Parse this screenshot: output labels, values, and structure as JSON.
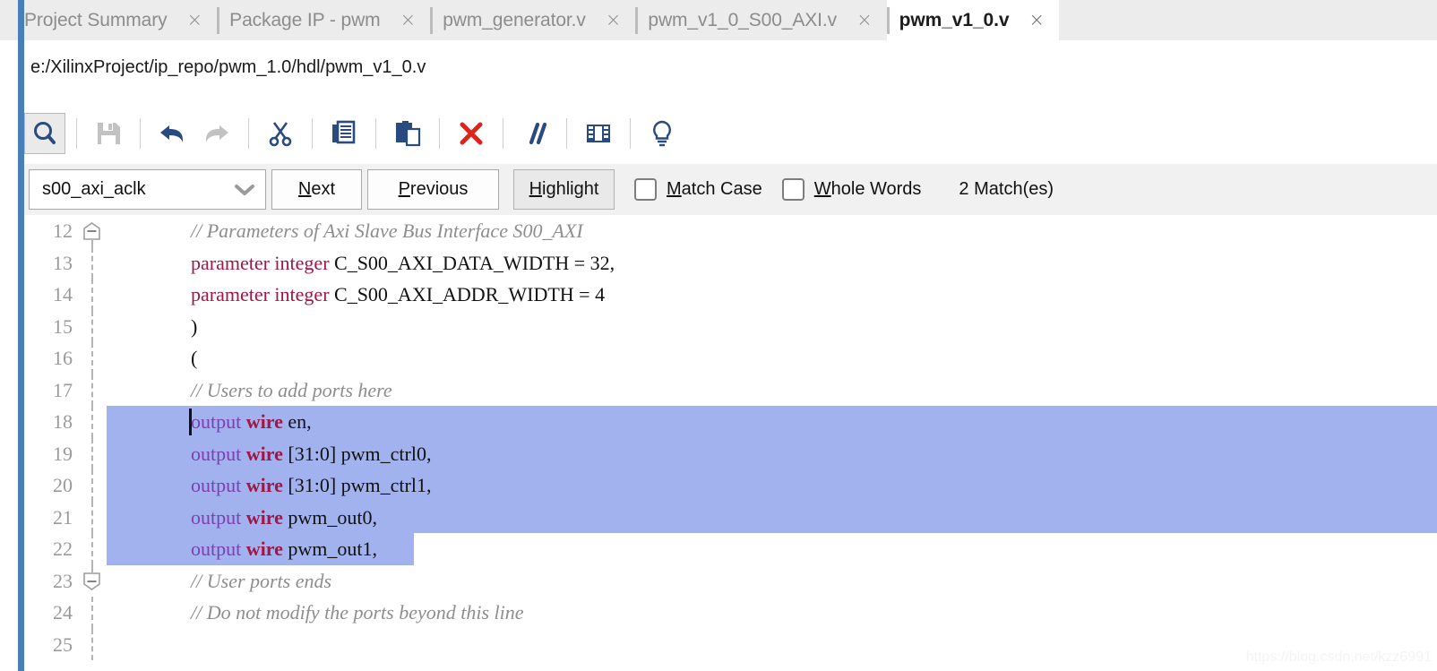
{
  "window": {
    "accent_color": "#4a7ebb",
    "tabbar_bg": "#ececec",
    "selection_color": "#a2b2ef",
    "keyword_color": "#a31545",
    "output_keyword_color": "#7c3fb0",
    "comment_color": "#8e8e8e"
  },
  "tabs": [
    {
      "label": "Project Summary",
      "close": "×",
      "active": false
    },
    {
      "label": "Package IP - pwm",
      "close": "×",
      "active": false
    },
    {
      "label": "pwm_generator.v",
      "close": "×",
      "active": false
    },
    {
      "label": "pwm_v1_0_S00_AXI.v",
      "close": "×",
      "active": false
    },
    {
      "label": "pwm_v1_0.v",
      "close": "×",
      "active": true
    }
  ],
  "filepath": {
    "text": "e:/XilinxProject/ip_repo/pwm_1.0/hdl/pwm_v1_0.v"
  },
  "toolbar": {
    "items": [
      {
        "name": "search-icon",
        "title": "Find",
        "state": "pressed"
      },
      {
        "name": "save-icon",
        "title": "Save File",
        "state": "disabled"
      },
      {
        "name": "undo-icon",
        "title": "Undo",
        "state": "enabled"
      },
      {
        "name": "redo-icon",
        "title": "Redo",
        "state": "disabled"
      },
      {
        "name": "cut-icon",
        "title": "Cut",
        "state": "enabled"
      },
      {
        "name": "copy-icon",
        "title": "Copy",
        "state": "enabled"
      },
      {
        "name": "paste-icon",
        "title": "Paste",
        "state": "enabled"
      },
      {
        "name": "delete-icon",
        "title": "Delete",
        "state": "enabled"
      },
      {
        "name": "comment-icon",
        "title": "Toggle Comment",
        "state": "enabled"
      },
      {
        "name": "split-view-icon",
        "title": "Split View",
        "state": "enabled"
      },
      {
        "name": "bulb-icon",
        "title": "Hints",
        "state": "enabled"
      }
    ]
  },
  "findbar": {
    "search_value": "s00_axi_aclk",
    "search_placeholder": "Find",
    "next_pre": "N",
    "next_post": "ext",
    "previous_pre": "P",
    "previous_post": "revious",
    "highlight_pre": "H",
    "highlight_post": "ighlight",
    "highlight_toggled": true,
    "match_case_pre": "M",
    "match_case_post": "atch Case",
    "match_case_checked": false,
    "whole_words_pre": "W",
    "whole_words_post": "hole Words",
    "whole_words_checked": false,
    "match_count": "2 Match(es)"
  },
  "code": {
    "lines": [
      {
        "number": "12",
        "fold": "start",
        "selected": false,
        "caret": false,
        "tokens": [
          {
            "t": "comment",
            "s": "// Parameters of Axi Slave Bus Interface S00_AXI"
          }
        ]
      },
      {
        "number": "13",
        "fold": "none",
        "selected": false,
        "caret": false,
        "indent": 2,
        "tokens": [
          {
            "t": "kw",
            "s": "parameter integer "
          },
          {
            "t": "plain",
            "s": "C_S00_AXI_DATA_WIDTH = 32,"
          }
        ]
      },
      {
        "number": "14",
        "fold": "none",
        "selected": false,
        "caret": false,
        "indent": 2,
        "tokens": [
          {
            "t": "kw",
            "s": "parameter integer "
          },
          {
            "t": "plain",
            "s": "C_S00_AXI_ADDR_WIDTH = 4"
          }
        ]
      },
      {
        "number": "15",
        "fold": "none",
        "selected": false,
        "caret": false,
        "indent": 1,
        "tokens": [
          {
            "t": "plain",
            "s": ")"
          }
        ]
      },
      {
        "number": "16",
        "fold": "none",
        "selected": false,
        "caret": false,
        "indent": 1,
        "tokens": [
          {
            "t": "plain",
            "s": "("
          }
        ]
      },
      {
        "number": "17",
        "fold": "none",
        "selected": false,
        "caret": false,
        "tokens": [
          {
            "t": "comment",
            "s": "// Users to add ports here"
          }
        ]
      },
      {
        "number": "18",
        "fold": "none",
        "selected": true,
        "sel_full": true,
        "caret": true,
        "tokens": [
          {
            "t": "out",
            "s": "output "
          },
          {
            "t": "kw-b",
            "s": "wire "
          },
          {
            "t": "plain",
            "s": "en,"
          }
        ]
      },
      {
        "number": "19",
        "fold": "none",
        "selected": true,
        "sel_full": true,
        "caret": false,
        "tokens": [
          {
            "t": "out",
            "s": "output "
          },
          {
            "t": "kw-b",
            "s": "wire "
          },
          {
            "t": "plain",
            "s": "[31:0] pwm_ctrl0,"
          }
        ]
      },
      {
        "number": "20",
        "fold": "none",
        "selected": true,
        "sel_full": true,
        "caret": false,
        "tokens": [
          {
            "t": "out",
            "s": "output "
          },
          {
            "t": "kw-b",
            "s": "wire "
          },
          {
            "t": "plain",
            "s": "[31:0] pwm_ctrl1,"
          }
        ]
      },
      {
        "number": "21",
        "fold": "none",
        "selected": true,
        "sel_full": true,
        "caret": false,
        "tokens": [
          {
            "t": "out",
            "s": "output "
          },
          {
            "t": "kw-b",
            "s": "wire "
          },
          {
            "t": "plain",
            "s": "pwm_out0,"
          }
        ]
      },
      {
        "number": "22",
        "fold": "none",
        "selected": true,
        "sel_full": false,
        "sel_width": 343,
        "caret": false,
        "tokens": [
          {
            "t": "out",
            "s": "output "
          },
          {
            "t": "kw-b",
            "s": "wire "
          },
          {
            "t": "plain",
            "s": "pwm_out1,"
          }
        ]
      },
      {
        "number": "23",
        "fold": "end",
        "selected": false,
        "caret": false,
        "tokens": [
          {
            "t": "comment",
            "s": "// User ports ends"
          }
        ]
      },
      {
        "number": "24",
        "fold": "none",
        "selected": false,
        "caret": false,
        "tokens": [
          {
            "t": "comment",
            "s": "// Do not modify the ports beyond this line"
          }
        ]
      },
      {
        "number": "25",
        "fold": "none",
        "selected": false,
        "caret": false,
        "tokens": []
      }
    ]
  },
  "watermark": {
    "text": "https://blog.csdn.net/kzz6991"
  }
}
